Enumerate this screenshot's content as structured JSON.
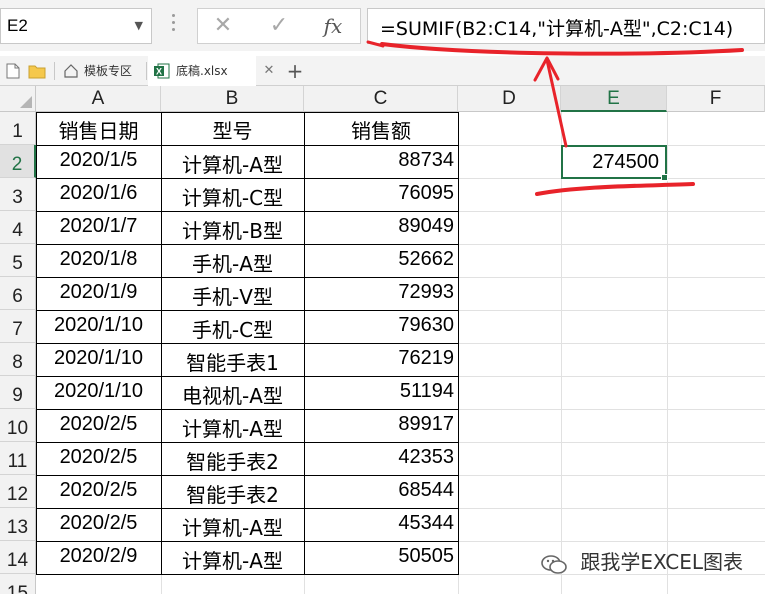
{
  "name_box": {
    "value": "E2"
  },
  "formula_bar": {
    "cancel_icon": "close-icon",
    "enter_icon": "check-icon",
    "fx_label": "fx",
    "formula": "=SUMIF(B2:C14,\"计算机-A型\",C2:C14)"
  },
  "tabs": [
    {
      "label": "模板专区",
      "icon": "home-icon",
      "active": false
    },
    {
      "label": "底稿.xlsx",
      "icon": "excel-file-icon",
      "active": true
    }
  ],
  "columns": [
    "A",
    "B",
    "C",
    "D",
    "E",
    "F"
  ],
  "rows": [
    "1",
    "2",
    "3",
    "4",
    "5",
    "6",
    "7",
    "8",
    "9",
    "10",
    "11",
    "12",
    "13",
    "14",
    "15"
  ],
  "table": {
    "headers": [
      "销售日期",
      "型号",
      "销售额"
    ],
    "rows": [
      [
        "2020/1/5",
        "计算机-A型",
        "88734"
      ],
      [
        "2020/1/6",
        "计算机-C型",
        "76095"
      ],
      [
        "2020/1/7",
        "计算机-B型",
        "89049"
      ],
      [
        "2020/1/8",
        "手机-A型",
        "52662"
      ],
      [
        "2020/1/9",
        "手机-V型",
        "72993"
      ],
      [
        "2020/1/10",
        "手机-C型",
        "79630"
      ],
      [
        "2020/1/10",
        "智能手表1",
        "76219"
      ],
      [
        "2020/1/10",
        "电视机-A型",
        "51194"
      ],
      [
        "2020/2/5",
        "计算机-A型",
        "89917"
      ],
      [
        "2020/2/5",
        "智能手表2",
        "42353"
      ],
      [
        "2020/2/5",
        "智能手表2",
        "68544"
      ],
      [
        "2020/2/5",
        "计算机-A型",
        "45344"
      ],
      [
        "2020/2/9",
        "计算机-A型",
        "50505"
      ]
    ]
  },
  "result_cell": {
    "ref": "E2",
    "value": "274500"
  },
  "watermark": {
    "text": "跟我学EXCEL图表"
  },
  "colors": {
    "accent_green": "#217346",
    "annotation_red": "#e8232a"
  }
}
